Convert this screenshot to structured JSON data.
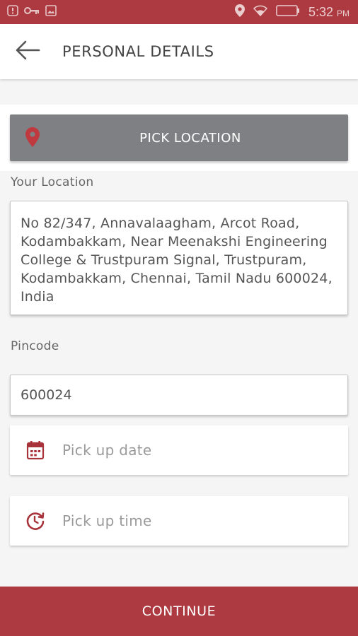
{
  "status_bar": {
    "time": "5:32",
    "ampm": "PM",
    "icons": [
      "alert-icon",
      "key-icon",
      "image-icon",
      "location-icon",
      "wifi-icon",
      "battery-icon"
    ]
  },
  "toolbar": {
    "title": "PERSONAL DETAILS",
    "back_icon": "arrow-left-icon"
  },
  "pick_location": {
    "label": "PICK LOCATION",
    "icon": "map-pin-icon"
  },
  "location": {
    "label": "Your Location",
    "value": "No 82/347, Annavalaagham, Arcot Road, Kodambakkam, Near Meenakshi Engineering College & Trustpuram Signal, Trustpuram, Kodambakkam, Chennai, Tamil Nadu 600024, India"
  },
  "pincode": {
    "label": "Pincode",
    "value": "600024"
  },
  "pickup_date": {
    "placeholder": "Pick up date",
    "icon": "calendar-icon"
  },
  "pickup_time": {
    "placeholder": "Pick up time",
    "icon": "clock-refresh-icon"
  },
  "continue": {
    "label": "CONTINUE"
  },
  "colors": {
    "accent": "#ad3a40",
    "pick_button": "#7e8083",
    "background": "#f5f5f5"
  }
}
